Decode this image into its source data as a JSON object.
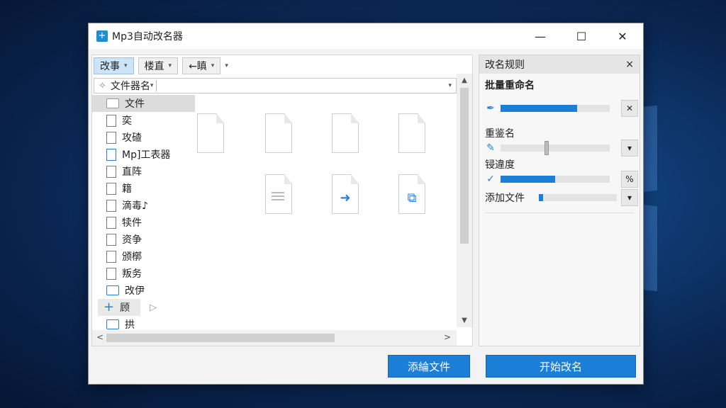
{
  "window": {
    "title": "Mp3自动改名器",
    "app_icon": "app-logo-icon",
    "controls": {
      "minimize": "—",
      "maximize": "☐",
      "close": "✕"
    }
  },
  "toolbar": {
    "buttons": [
      {
        "label": "改事",
        "caret": "▾"
      },
      {
        "label": "楼直",
        "caret": "▾"
      },
      {
        "label": "←瞋",
        "caret": "▾"
      }
    ],
    "extra_caret": "▾"
  },
  "address_bar": {
    "label": "文件器名",
    "caret": "▾",
    "icon": "sparkle-icon"
  },
  "tree": [
    {
      "label": "文件",
      "icon": "folder-gray-icon"
    },
    {
      "label": "奕",
      "icon": "document-icon"
    },
    {
      "label": "攻碴",
      "icon": "document-icon"
    },
    {
      "label": "Mp]工表器",
      "icon": "document-blue-icon"
    },
    {
      "label": "直阵",
      "icon": "document-icon"
    },
    {
      "label": "籍",
      "icon": "document-icon"
    },
    {
      "label": "滴毒♪",
      "icon": "document-icon"
    },
    {
      "label": "犊件",
      "icon": "document-icon"
    },
    {
      "label": "资争",
      "icon": "document-icon"
    },
    {
      "label": "颁槨",
      "icon": "document-icon"
    },
    {
      "label": "叛务",
      "icon": "document-icon"
    },
    {
      "label": "改伊",
      "icon": "folder-icon"
    },
    {
      "label": "顾",
      "icon": "plus-icon"
    },
    {
      "label": "拱",
      "icon": "folder-icon"
    }
  ],
  "scroll": {
    "up": "▲",
    "down": "▼",
    "left": "<",
    "right": ">"
  },
  "rules_panel": {
    "header": "改名规则",
    "close": "×",
    "subtitle": "批量重命名",
    "rows": [
      {
        "label": "",
        "icon": "pen-icon",
        "value": 0.7,
        "btn": "✕"
      },
      {
        "label": "重鉴名",
        "icon": "pencil-icon",
        "value": 0.4,
        "btn": "▾"
      },
      {
        "label": "锓違度",
        "icon": "check-icon",
        "value": 0.5,
        "btn": "%"
      },
      {
        "label": "添加文件",
        "icon": "",
        "value": 0.05,
        "btn": "▾"
      }
    ]
  },
  "buttons": {
    "add_files": "添綸文件",
    "start_rename": "开始改名"
  },
  "colors": {
    "accent": "#1b7fd8",
    "desktop": "#0f3a72"
  }
}
